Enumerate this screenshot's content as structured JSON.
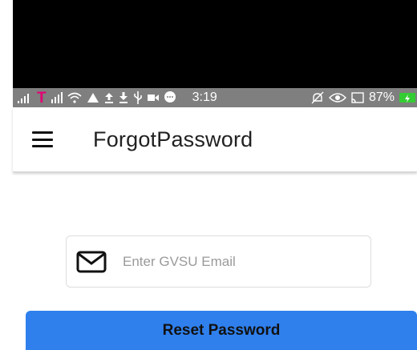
{
  "status_bar": {
    "time": "3:19",
    "battery_percent": "87%",
    "carrier_glyph": "T",
    "icons_left": [
      "signal-icon",
      "tmobile-icon",
      "signal-icon",
      "wifi-icon",
      "warning-icon",
      "upload-icon",
      "download-icon",
      "usb-icon",
      "video-icon",
      "chat-icon"
    ],
    "icons_right": [
      "mute-icon",
      "eye-icon",
      "cast-icon",
      "battery-icon"
    ]
  },
  "app_bar": {
    "title": "ForgotPassword",
    "menu_icon": "hamburger-menu-icon"
  },
  "form": {
    "email_placeholder": "Enter GVSU Email",
    "email_value": "",
    "email_icon": "mail-icon",
    "reset_button_label": "Reset Password"
  },
  "colors": {
    "status_bar": "#7f7f7f",
    "primary_button": "#2f80ed",
    "tmobile": "#e20074",
    "battery": "#33cc33"
  }
}
